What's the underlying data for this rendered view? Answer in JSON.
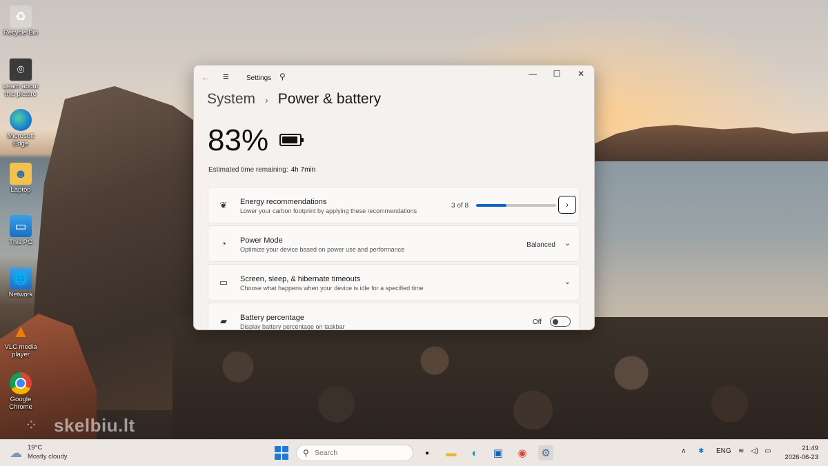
{
  "desktop": {
    "icons": [
      {
        "label": "Recycle Bin",
        "icon": "recycle-bin-icon"
      },
      {
        "label": "Learn about this picture",
        "icon": "learn-about-picture-icon"
      },
      {
        "label": "Microsoft Edge",
        "icon": "edge-icon"
      },
      {
        "label": "Laptop",
        "icon": "user-folder-icon"
      },
      {
        "label": "This PC",
        "icon": "this-pc-icon"
      },
      {
        "label": "Network",
        "icon": "network-icon"
      },
      {
        "label": "VLC media player",
        "icon": "vlc-icon"
      },
      {
        "label": "Google Chrome",
        "icon": "chrome-icon"
      }
    ],
    "watermark": "skelbiu.lt"
  },
  "window": {
    "title": "Settings",
    "breadcrumb": {
      "parent": "System",
      "current": "Power & battery"
    },
    "battery": {
      "percent_text": "83%",
      "level": 0.83
    },
    "estimate": {
      "label": "Estimated time remaining:",
      "value": "4h 7min"
    },
    "cards": {
      "energy": {
        "title": "Energy recommendations",
        "subtitle": "Lower your carbon footprint by applying these recommendations",
        "count": "3 of 8",
        "progress": 0.375,
        "icon": "leaf-icon"
      },
      "power_mode": {
        "title": "Power Mode",
        "subtitle": "Optimize your device based on power use and performance",
        "value": "Balanced",
        "icon": "gauge-icon"
      },
      "timeouts": {
        "title": "Screen, sleep, & hibernate timeouts",
        "subtitle": "Choose what happens when your device is idle for a specified time",
        "icon": "screen-sleep-icon"
      },
      "battery_pct": {
        "title": "Battery percentage",
        "subtitle": "Display battery percentage on taskbar",
        "toggle_label": "Off",
        "icon": "battery-charging-icon"
      }
    }
  },
  "taskbar": {
    "weather": {
      "temp": "19°C",
      "desc": "Mostly cloudy",
      "icon": "cloud-sun-icon"
    },
    "search_placeholder": "Search",
    "tray": {
      "language": "ENG"
    },
    "clock": {
      "time": "21:49",
      "date": "2026-06-23"
    },
    "colors": {
      "accent": "#0f67c4",
      "start": "#1e7ad8"
    }
  }
}
